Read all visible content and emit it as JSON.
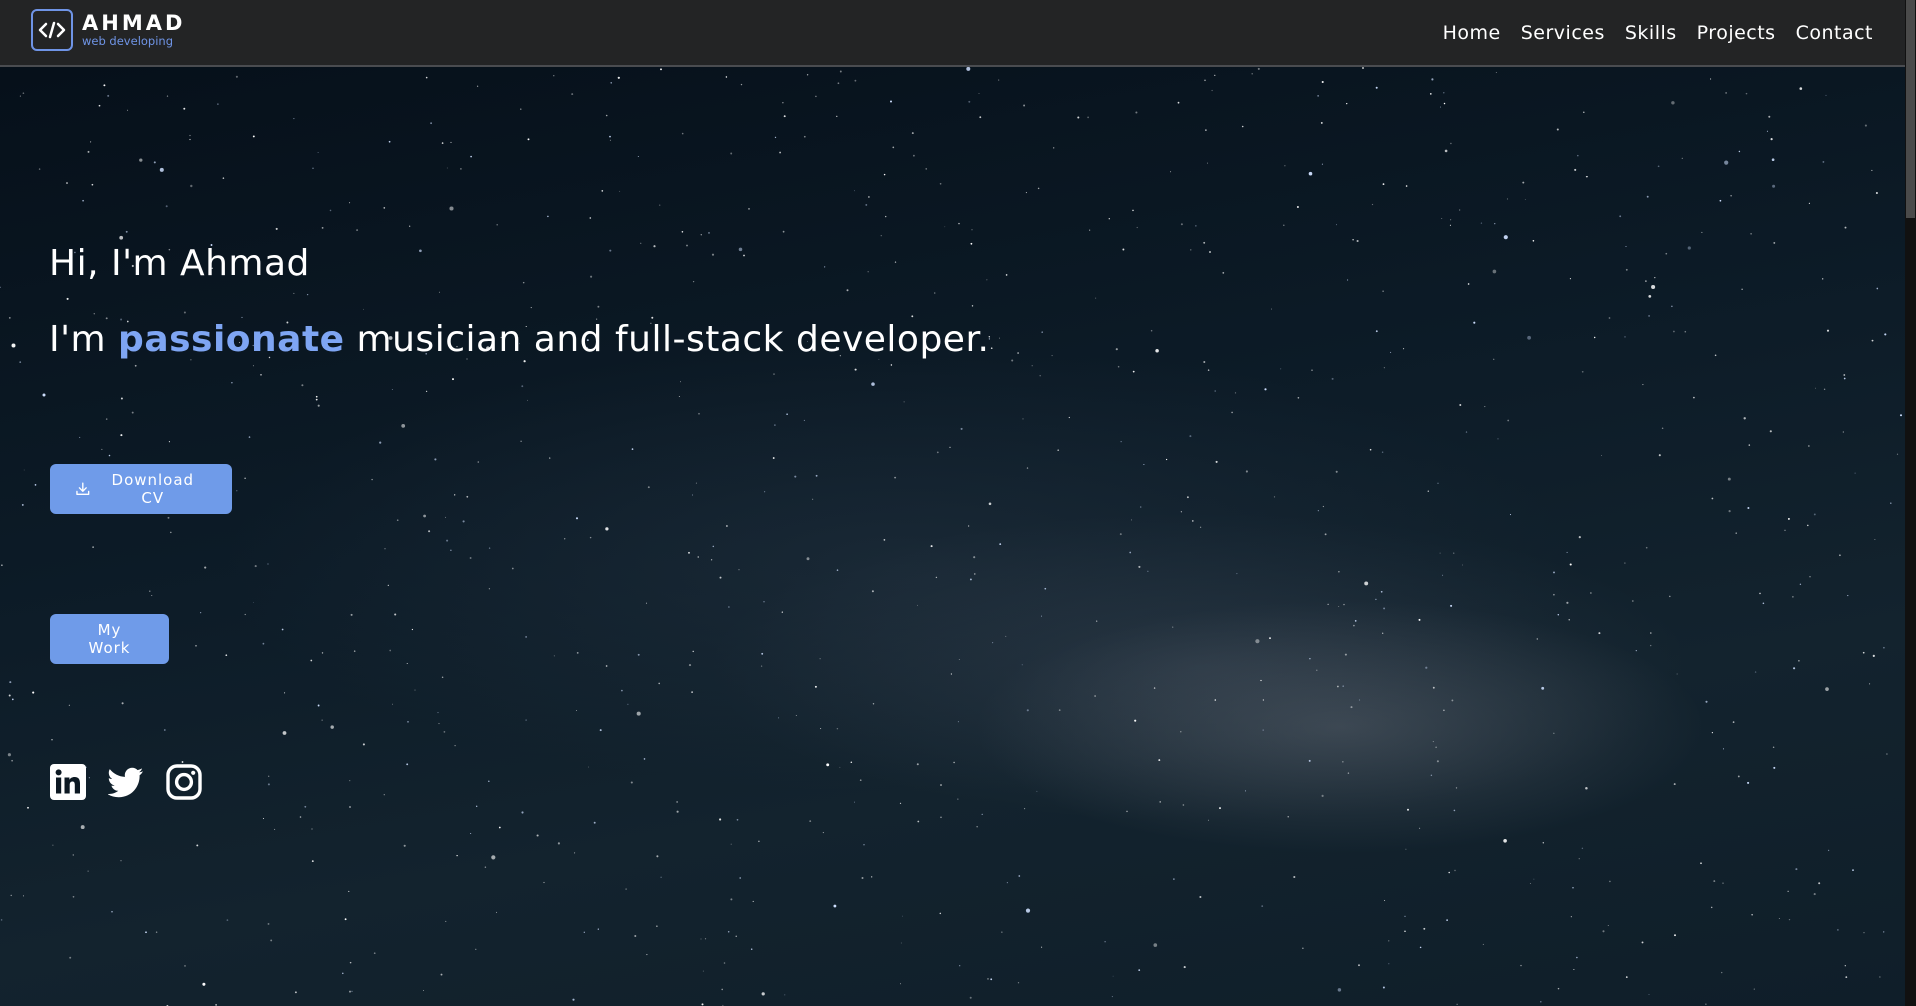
{
  "brand": {
    "name": "AHMAD",
    "tagline": "web developing",
    "logo_glyph": "</>",
    "color": "#6f94e6"
  },
  "nav": {
    "items": [
      {
        "label": "Home"
      },
      {
        "label": "Services"
      },
      {
        "label": "Skills"
      },
      {
        "label": "Projects"
      },
      {
        "label": "Contact"
      }
    ]
  },
  "hero": {
    "greeting": "Hi, I'm Ahmad",
    "tagline_prefix": "I'm",
    "tagline_accent": "passionate",
    "tagline_suffix": "musician and full-stack developer.",
    "accent_color": "#7ea5f3",
    "download_cv_label": "Download CV",
    "download_icon": "download-icon",
    "my_work_label": "My Work",
    "button_color": "#6f9be9"
  },
  "socials": [
    {
      "icon": "linkedin-icon"
    },
    {
      "icon": "twitter-icon"
    },
    {
      "icon": "instagram-icon"
    }
  ]
}
